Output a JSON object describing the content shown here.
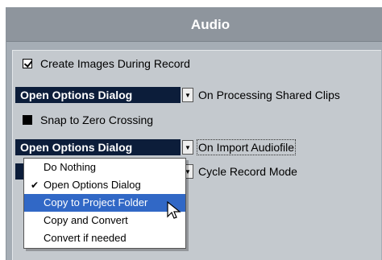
{
  "panel": {
    "title": "Audio"
  },
  "settings": {
    "create_images": {
      "label": "Create Images During Record",
      "checked": true
    },
    "processing_shared": {
      "value": "Open Options Dialog",
      "label": "On Processing Shared Clips"
    },
    "snap_zero": {
      "label": "Snap to Zero Crossing",
      "checked": false
    },
    "import_audio": {
      "value": "Open Options Dialog",
      "label": "On Import Audiofile"
    },
    "cycle_record": {
      "label": "Cycle Record Mode"
    }
  },
  "popup": {
    "items": [
      {
        "label": "Do Nothing",
        "checked": false
      },
      {
        "label": "Open Options Dialog",
        "checked": true
      },
      {
        "label": "Copy to Project Folder",
        "checked": false
      },
      {
        "label": "Copy and Convert",
        "checked": false
      },
      {
        "label": "Convert if needed",
        "checked": false
      }
    ],
    "highlighted_index": 2,
    "check_glyph": "✔"
  },
  "icons": {
    "dropdown_arrow": "chevron-down-icon",
    "cursor": "mouse-pointer-icon"
  },
  "colors": {
    "dropdown_bg": "#0c1d3a",
    "highlight": "#3168c6",
    "panel_bg": "#c4c9ce",
    "header_bg": "#8e959d"
  }
}
